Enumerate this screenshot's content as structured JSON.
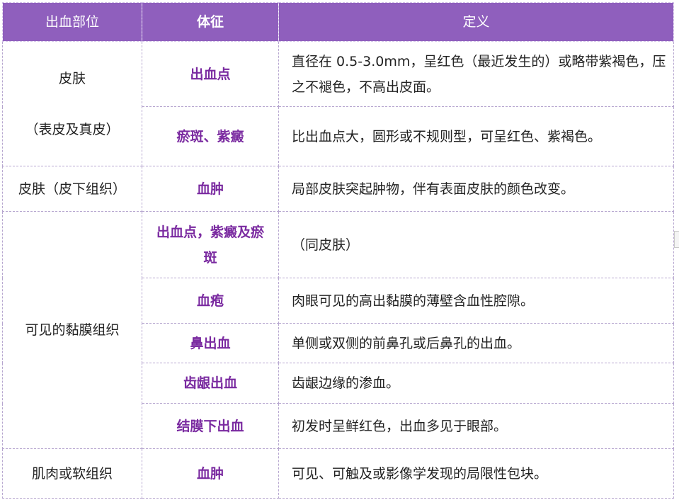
{
  "header": {
    "col1": "出血部位",
    "col2": "体征",
    "col3": "定义"
  },
  "rows": [
    {
      "part_lines": [
        "皮肤",
        "（表皮及真皮）"
      ],
      "sign": "出血点",
      "definition": "直径在 0.5-3.0mm，呈红色（最近发生的）或略带紫褐色，压之不褪色，不高出皮面。"
    },
    {
      "sign": "瘀斑、紫癜",
      "definition": "比出血点大，圆形或不规则型，可呈红色、紫褐色。"
    },
    {
      "part": "皮肤（皮下组织）",
      "sign": "血肿",
      "definition": "局部皮肤突起肿物，伴有表面皮肤的颜色改变。"
    },
    {
      "part": "可见的黏膜组织",
      "sign": "出血点，紫癜及瘀斑",
      "definition": "（同皮肤）"
    },
    {
      "sign": "血疱",
      "definition": "肉眼可见的高出黏膜的薄壁含血性腔隙。"
    },
    {
      "sign": "鼻出血",
      "definition": "单侧或双侧的前鼻孔或后鼻孔的出血。"
    },
    {
      "sign": "齿龈出血",
      "definition": "齿龈边缘的渗血。"
    },
    {
      "sign": "结膜下出血",
      "definition": "初发时呈鲜红色，出血多见于眼部。"
    },
    {
      "part": "肌肉或软组织",
      "sign": "血肿",
      "definition": "可见、可触及或影像学发现的局限性包块。"
    }
  ]
}
